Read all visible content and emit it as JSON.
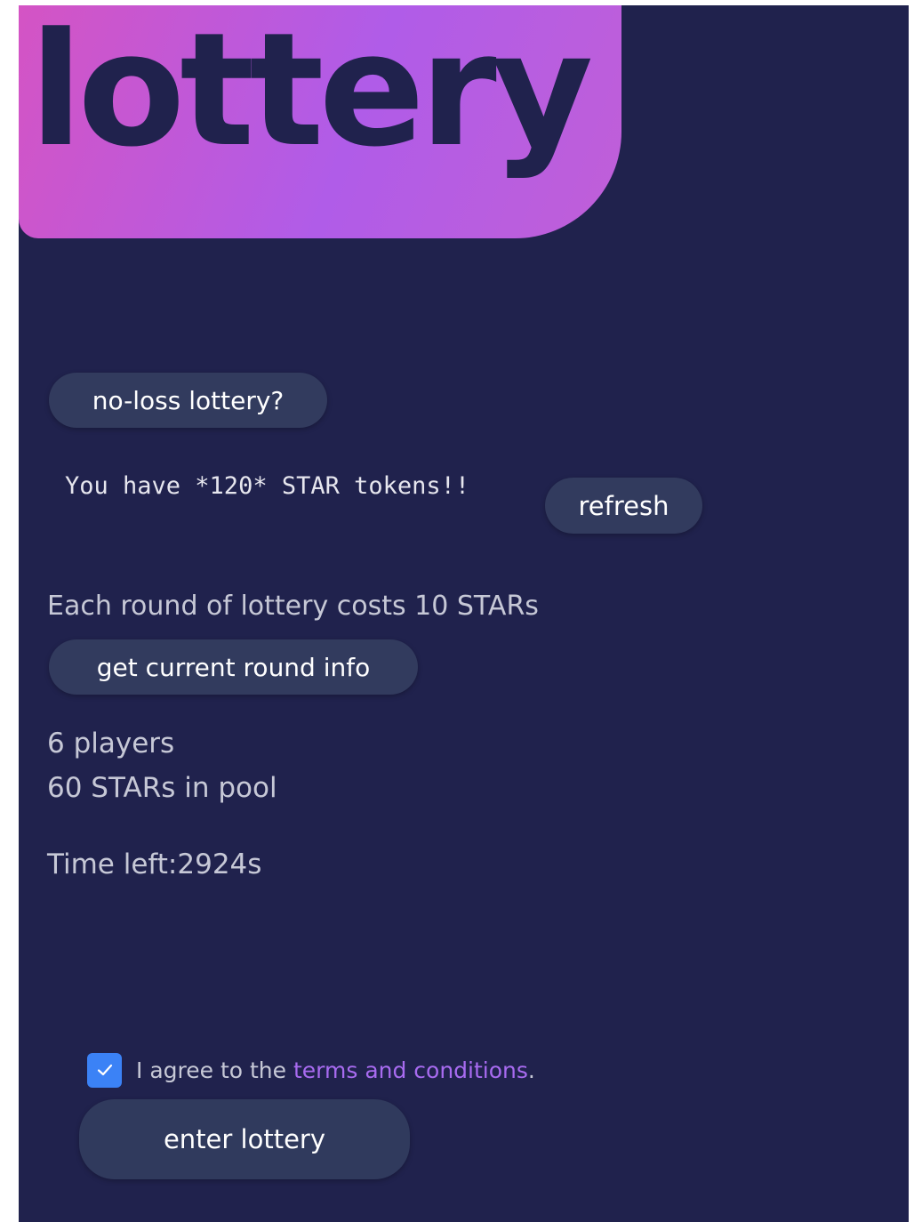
{
  "header": {
    "title": "lottery"
  },
  "info": {
    "noloss_button": "no-loss lottery?",
    "balance_text": "You have *120* STAR tokens!!",
    "refresh_button": "refresh",
    "cost_text": "Each round of lottery costs 10 STARs",
    "round_info_button": "get current round info",
    "players_text": "6 players",
    "pool_text": "60 STARs in pool",
    "time_left_text": "Time left:2924s"
  },
  "agreement": {
    "checked": true,
    "prefix": "I agree to the ",
    "link_text": "terms and conditions",
    "suffix": "."
  },
  "enter_button": "enter lottery",
  "colors": {
    "background": "#20224d",
    "button": "#323b5e",
    "accent_link": "#a86bf0",
    "checkbox": "#3b82f6",
    "hero_gradient_start": "#d454c4",
    "hero_gradient_end": "#b05ce8"
  }
}
